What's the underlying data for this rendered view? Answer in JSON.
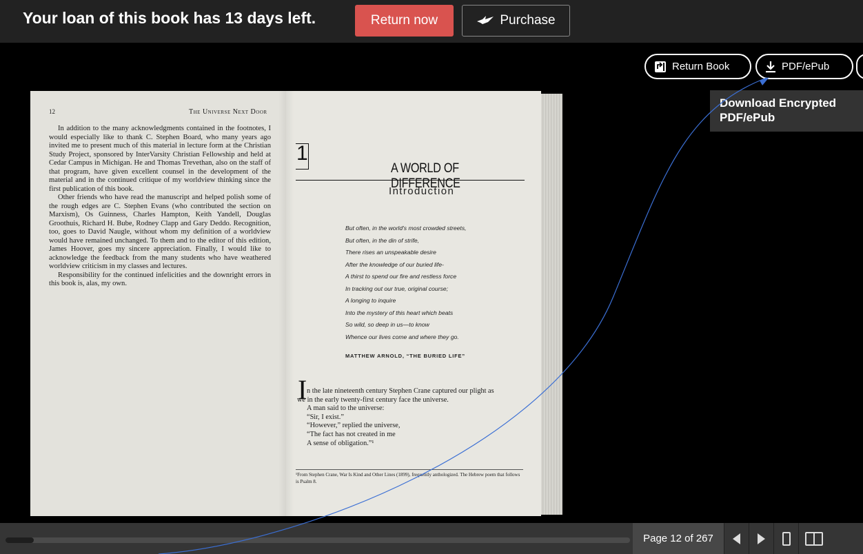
{
  "loan_bar": {
    "message": "Your loan of this book has 13 days left.",
    "return_now_label": "Return now",
    "purchase_label": "Purchase"
  },
  "toolbar": {
    "return_book_label": "Return Book",
    "pdf_label": "PDF/ePub",
    "tooltip": "Download Encrypted PDF/ePub"
  },
  "book": {
    "left_page": {
      "page_number": "12",
      "running_head": "The Universe Next Door",
      "paragraphs": [
        "In addition to the many acknowledgments contained in the footnotes, I would especially like to thank C. Stephen Board, who many years ago invited me to present much of this material in lecture form at the Christian Study Project, sponsored by InterVarsity Christian Fellowship and held at Cedar Campus in Michigan. He and Thomas Trevethan, also on the staff of that program, have given excellent counsel in the development of the material and in the continued critique of my worldview thinking since the first publication of this book.",
        "Other friends who have read the manuscript and helped polish some of the rough edges are C. Stephen Evans (who contributed the section on Marxism), Os Guinness, Charles Hampton, Keith Yandell, Douglas Groothuis, Richard H. Bube, Rodney Clapp and Gary Deddo. Recognition, too, goes to David Naugle, without whom my definition of a worldview would have remained unchanged. To them and to the editor of this edition, James Hoover, goes my sincere appreciation. Finally, I would like to acknowledge the feedback from the many students who have weathered worldview criticism in my classes and lectures.",
        "Responsibility for the continued infelicities and the downright errors in this book is, alas, my own."
      ]
    },
    "right_page": {
      "chapter_number": "1",
      "chapter_title": "A WORLD OF DIFFERENCE",
      "chapter_subtitle": "Introduction",
      "epigraph_lines": [
        "But often, in the world's most crowded streets,",
        "But often, in the din of strife,",
        "There rises an unspeakable desire",
        "After the knowledge of our buried life-",
        "A thirst to spend our fire and restless force",
        "In tracking out our true, original course;",
        "A longing to inquire",
        "Into the mystery of this heart which beats",
        "So wild, so deep in us—to know",
        "Whence our lives come and where they go."
      ],
      "epigraph_attribution": "MATTHEW ARNOLD, “THE BURIED LIFE”",
      "drop_cap": "I",
      "body_first": "n the late nineteenth century Stephen Crane captured our plight as",
      "body_second": "we in the early twenty-first century face the universe.",
      "verse_lines": [
        "A man said to the universe:",
        "“Sir, I exist.”",
        "“However,” replied the universe,",
        "“The fact has not created in me",
        "A sense of obligation.”¹"
      ],
      "footnote": "¹From Stephen Crane, War Is Kind and Other Lines (1899), frequently anthologized. The Hebrew poem that follows is Psalm 8."
    }
  },
  "bottom_bar": {
    "page_indicator": "Page 12 of 267",
    "progress_fraction": 0.045
  },
  "colors": {
    "return_now_bg": "#d9534f",
    "annotation_line": "#3b6fd4"
  },
  "icons": {
    "purchase": "bird-icon",
    "return_book": "return-book-icon",
    "pdf": "download-icon"
  }
}
